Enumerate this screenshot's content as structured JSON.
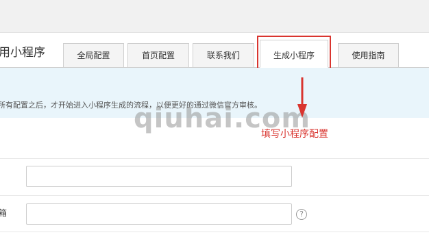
{
  "header": {
    "title": "用小程序"
  },
  "tabs": [
    {
      "label": "全局配置"
    },
    {
      "label": "首页配置"
    },
    {
      "label": "联系我们"
    },
    {
      "label": "生成小程序",
      "active": true
    },
    {
      "label": "使用指南"
    }
  ],
  "notice": {
    "text": "所有配置之后，才开始进入小程序生成的流程，以便更好的通过微信官方审核。"
  },
  "watermark": {
    "text": "qiuhai.com"
  },
  "annotation": {
    "text": "填写小程序配置",
    "color": "#d9352f"
  },
  "form": {
    "row2_label": "箱",
    "help_icon": "?"
  },
  "colors": {
    "notice_bg": "#e9f5fb",
    "accent_red": "#d9352f"
  }
}
